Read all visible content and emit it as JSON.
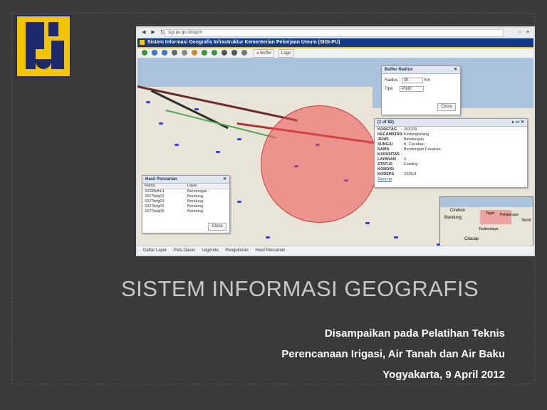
{
  "browser": {
    "url": "sigi.pu.go.id/sigi/#",
    "nav_glyphs": "◀ ▶ C",
    "right_glyphs": "☆ ≡"
  },
  "app": {
    "title": "Sistem Informasi Geografis Infrastruktur Kementerian Pekerjaan Umum (SIGI-PU)"
  },
  "toolbar": {
    "buffer_label": "Buffer",
    "logout_label": "Logo"
  },
  "buffer_panel": {
    "title": "Buffer Radius",
    "radius_label": "Radius :",
    "radius_value": "30",
    "radius_unit": "Km",
    "type_label": "Tipe",
    "type_value": "Point",
    "close_label": "Close"
  },
  "info_panel": {
    "pager": "(1 of 82)",
    "fields": [
      {
        "key": "KODETAG",
        "value": ": 303328"
      },
      {
        "key": "KECAMATAN",
        "value": ": Kedungkelang"
      },
      {
        "key": "JENIS",
        "value": ": Bendungan"
      },
      {
        "key": "SUNGAI",
        "value": ": K. Cacaban"
      },
      {
        "key": "NAMA",
        "value": ": Bendungan Cacaban"
      },
      {
        "key": "KAPASITAS",
        "value": ":"
      },
      {
        "key": "LAYANAN",
        "value": ": 3"
      },
      {
        "key": "STATUS",
        "value": ": Existing"
      },
      {
        "key": "KONDISI",
        "value": ":"
      },
      {
        "key": "KODEPS",
        "value": ": 3328x1"
      }
    ],
    "zoom_label": "Zoom to"
  },
  "results_panel": {
    "title": "Hasil Pencarian",
    "columns": [
      "Nama",
      "Layer"
    ],
    "rows": [
      [
        "3328Bdh01",
        "Bendungan"
      ],
      [
        "3327bdg02",
        "Bendung"
      ],
      [
        "3327bdg03",
        "Bendung"
      ],
      [
        "3327bdg06",
        "Bendung"
      ],
      [
        "3327bdg05",
        "Bendung"
      ]
    ],
    "close_label": "Close"
  },
  "minimap": {
    "labels": [
      "Cirebon",
      "Bandung",
      "Tegal",
      "Pekalongan",
      "Semi",
      "Tasikmalaya",
      "Cilacap"
    ]
  },
  "statusbar": {
    "items": [
      "Daftar Layer",
      "Peta Dasar",
      "Legenda",
      "Pengukuran",
      "Hasil Pencarian"
    ]
  },
  "slide": {
    "title": "SISTEM INFORMASI GEOGRAFIS",
    "line1": "Disampaikan pada Pelatihan Teknis",
    "line2": "Perencanaan Irigasi, Air Tanah dan Air Baku",
    "line3": "Yogyakarta, 9 April 2012"
  },
  "colors": {
    "background": "#3a3a3a",
    "logo_yellow": "#f3c400",
    "logo_navy": "#1d2a6b",
    "app_header": "#123a8a",
    "buffer_circle": "#f05050"
  }
}
